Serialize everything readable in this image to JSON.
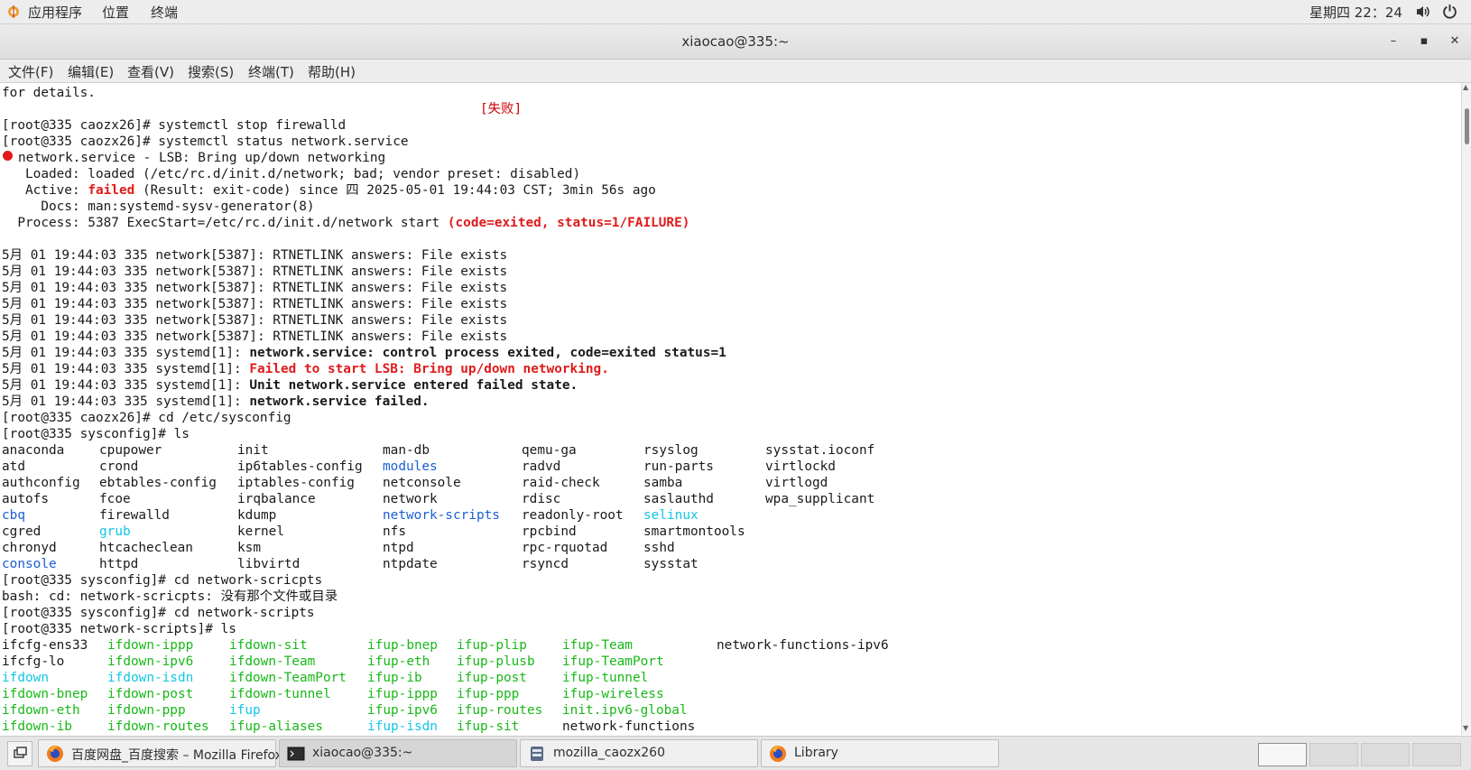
{
  "top_panel": {
    "apps": "应用程序",
    "places": "位置",
    "terminal": "终端",
    "clock": "星期四 22：24"
  },
  "window": {
    "title": "xiaocao@335:~",
    "minimize": "–",
    "maximize": "▪",
    "close": "✕"
  },
  "menubar": {
    "file": "文件(F)",
    "edit": "编辑(E)",
    "view": "查看(V)",
    "search": "搜索(S)",
    "terminal": "终端(T)",
    "help": "帮助(H)"
  },
  "terminal": {
    "lines": {
      "l0": "for details.",
      "l1_fail": "[失败]",
      "l2": "[root@335 caozx26]# systemctl stop firewalld",
      "l3": "[root@335 caozx26]# systemctl status network.service",
      "l4": "network.service - LSB: Bring up/down networking",
      "l5": "   Loaded: loaded (/etc/rc.d/init.d/network; bad; vendor preset: disabled)",
      "l6a": "   Active: ",
      "l6b": "failed",
      "l6c": " (Result: exit-code) since 四 2025-05-01 19:44:03 CST; 3min 56s ago",
      "l7": "     Docs: man:systemd-sysv-generator(8)",
      "l8a": "  Process: 5387 ExecStart=/etc/rc.d/init.d/network start ",
      "l8b": "(code=exited, status=1/FAILURE)",
      "l10": "5月 01 19:44:03 335 network[5387]: RTNETLINK answers: File exists",
      "l11": "5月 01 19:44:03 335 network[5387]: RTNETLINK answers: File exists",
      "l12": "5月 01 19:44:03 335 network[5387]: RTNETLINK answers: File exists",
      "l13": "5月 01 19:44:03 335 network[5387]: RTNETLINK answers: File exists",
      "l14": "5月 01 19:44:03 335 network[5387]: RTNETLINK answers: File exists",
      "l15": "5月 01 19:44:03 335 network[5387]: RTNETLINK answers: File exists",
      "l16a": "5月 01 19:44:03 335 systemd[1]: ",
      "l16b": "network.service: control process exited, code=exited status=1",
      "l17a": "5月 01 19:44:03 335 systemd[1]: ",
      "l17b": "Failed to start LSB: Bring up/down networking.",
      "l18a": "5月 01 19:44:03 335 systemd[1]: ",
      "l18b": "Unit network.service entered failed state.",
      "l19a": "5月 01 19:44:03 335 systemd[1]: ",
      "l19b": "network.service failed.",
      "l20": "[root@335 caozx26]# cd /etc/sysconfig",
      "l21": "[root@335 sysconfig]# ls",
      "l30": "[root@335 sysconfig]# cd network-scricpts",
      "l31": "bash: cd: network-scricpts: 没有那个文件或目录",
      "l32": "[root@335 sysconfig]# cd network-scripts",
      "l33": "[root@335 network-scripts]# ls"
    },
    "sysconfig_ls": [
      [
        "anaconda",
        "cpupower",
        "init",
        "man-db",
        "qemu-ga",
        "rsyslog",
        "sysstat.ioconf"
      ],
      [
        "atd",
        "crond",
        "ip6tables-config",
        "modules",
        "radvd",
        "run-parts",
        "virtlockd"
      ],
      [
        "authconfig",
        "ebtables-config",
        "iptables-config",
        "netconsole",
        "raid-check",
        "samba",
        "virtlogd"
      ],
      [
        "autofs",
        "fcoe",
        "irqbalance",
        "network",
        "rdisc",
        "saslauthd",
        "wpa_supplicant"
      ],
      [
        "cbq",
        "firewalld",
        "kdump",
        "network-scripts",
        "readonly-root",
        "selinux",
        ""
      ],
      [
        "cgred",
        "grub",
        "kernel",
        "nfs",
        "rpcbind",
        "smartmontools",
        ""
      ],
      [
        "chronyd",
        "htcacheclean",
        "ksm",
        "ntpd",
        "rpc-rquotad",
        "sshd",
        ""
      ],
      [
        "console",
        "httpd",
        "libvirtd",
        "ntpdate",
        "rsyncd",
        "sysstat",
        ""
      ]
    ],
    "sysconfig_ls_colors": [
      [
        "",
        "",
        "",
        "",
        "",
        "",
        ""
      ],
      [
        "",
        "",
        "",
        "blue",
        "",
        "",
        ""
      ],
      [
        "",
        "",
        "",
        "",
        "",
        "",
        ""
      ],
      [
        "",
        "",
        "",
        "",
        "",
        "",
        ""
      ],
      [
        "blue",
        "",
        "",
        "blue",
        "",
        "cyan",
        ""
      ],
      [
        "",
        "cyan",
        "",
        "",
        "",
        "",
        ""
      ],
      [
        "",
        "",
        "",
        "",
        "",
        "",
        ""
      ],
      [
        "blue",
        "",
        "",
        "",
        "",
        "",
        ""
      ]
    ],
    "netscripts_ls": [
      [
        "ifcfg-ens33",
        "ifdown-ippp",
        "ifdown-sit",
        "ifup-bnep",
        "ifup-plip",
        "ifup-Team",
        "network-functions-ipv6"
      ],
      [
        "ifcfg-lo",
        "ifdown-ipv6",
        "ifdown-Team",
        "ifup-eth",
        "ifup-plusb",
        "ifup-TeamPort",
        ""
      ],
      [
        "ifdown",
        "ifdown-isdn",
        "ifdown-TeamPort",
        "ifup-ib",
        "ifup-post",
        "ifup-tunnel",
        ""
      ],
      [
        "ifdown-bnep",
        "ifdown-post",
        "ifdown-tunnel",
        "ifup-ippp",
        "ifup-ppp",
        "ifup-wireless",
        ""
      ],
      [
        "ifdown-eth",
        "ifdown-ppp",
        "ifup",
        "ifup-ipv6",
        "ifup-routes",
        "init.ipv6-global",
        ""
      ],
      [
        "ifdown-ib",
        "ifdown-routes",
        "ifup-aliases",
        "ifup-isdn",
        "ifup-sit",
        "network-functions",
        ""
      ]
    ],
    "netscripts_ls_colors": [
      [
        "",
        "green",
        "green",
        "green",
        "green",
        "green",
        ""
      ],
      [
        "",
        "green",
        "green",
        "green",
        "green",
        "green",
        ""
      ],
      [
        "cyan",
        "cyan",
        "green",
        "green",
        "green",
        "green",
        ""
      ],
      [
        "green",
        "green",
        "green",
        "green",
        "green",
        "green",
        ""
      ],
      [
        "green",
        "green",
        "cyan",
        "green",
        "green",
        "green",
        ""
      ],
      [
        "green",
        "green",
        "green",
        "cyan",
        "green",
        "",
        ""
      ]
    ],
    "colors": {
      "red": "#cc0000",
      "blue": "#1a5fd6",
      "cyan": "#12c6e3",
      "green": "#18b818"
    }
  },
  "taskbar": {
    "tasks": [
      {
        "label": "百度网盘_百度搜索 – Mozilla Firefox",
        "icon": "firefox-icon"
      },
      {
        "label": "xiaocao@335:~",
        "icon": "terminal-icon"
      },
      {
        "label": "mozilla_caozx260",
        "icon": "file-manager-icon"
      },
      {
        "label": "Library",
        "icon": "firefox-icon"
      }
    ]
  }
}
